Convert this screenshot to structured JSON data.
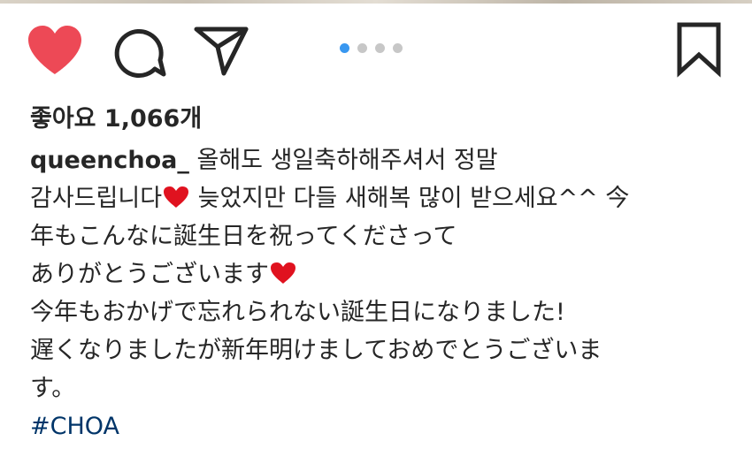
{
  "post_actions": {
    "like_icon": "heart-filled-icon",
    "comment_icon": "comment-bubble-icon",
    "share_icon": "paper-plane-icon",
    "save_icon": "bookmark-icon",
    "like_color": "#ed4956",
    "carousel": {
      "count": 4,
      "active_index": 1,
      "active_color": "#3897f0",
      "inactive_color": "#c7c7c7"
    }
  },
  "likes": {
    "label": "좋아요 1,066개"
  },
  "caption": {
    "username": "queenchoa_",
    "line1_text": " 올해도 생일축하해주셔서 정말",
    "line2_part1": "감사드립니다",
    "line2_part2": " 늦었지만 다들 새해복 많이 받으세요^^ 今",
    "line3": "年もこんなに誕生日を祝ってくださって",
    "line4": "ありがとうございます",
    "line5": "今年もおかげで忘れられない誕生日になりました!",
    "line6": "遅くなりましたが新年明けましておめでとうございま",
    "line7": "す。",
    "hashtag": "#CHOA",
    "hashtag_color": "#003569",
    "emoji": "red-heart-emoji"
  }
}
